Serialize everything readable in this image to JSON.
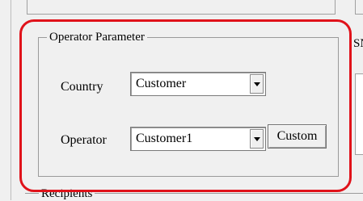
{
  "operator_group": {
    "title": "Operator Parameter",
    "country_label": "Country",
    "country_value": "Customer",
    "operator_label": "Operator",
    "operator_value": "Customer1",
    "custom_button": "Custom"
  },
  "side": {
    "sn_label": "SN"
  },
  "recipients_group": {
    "title": "Recipients"
  },
  "highlight": {
    "color": "#e0121a"
  }
}
